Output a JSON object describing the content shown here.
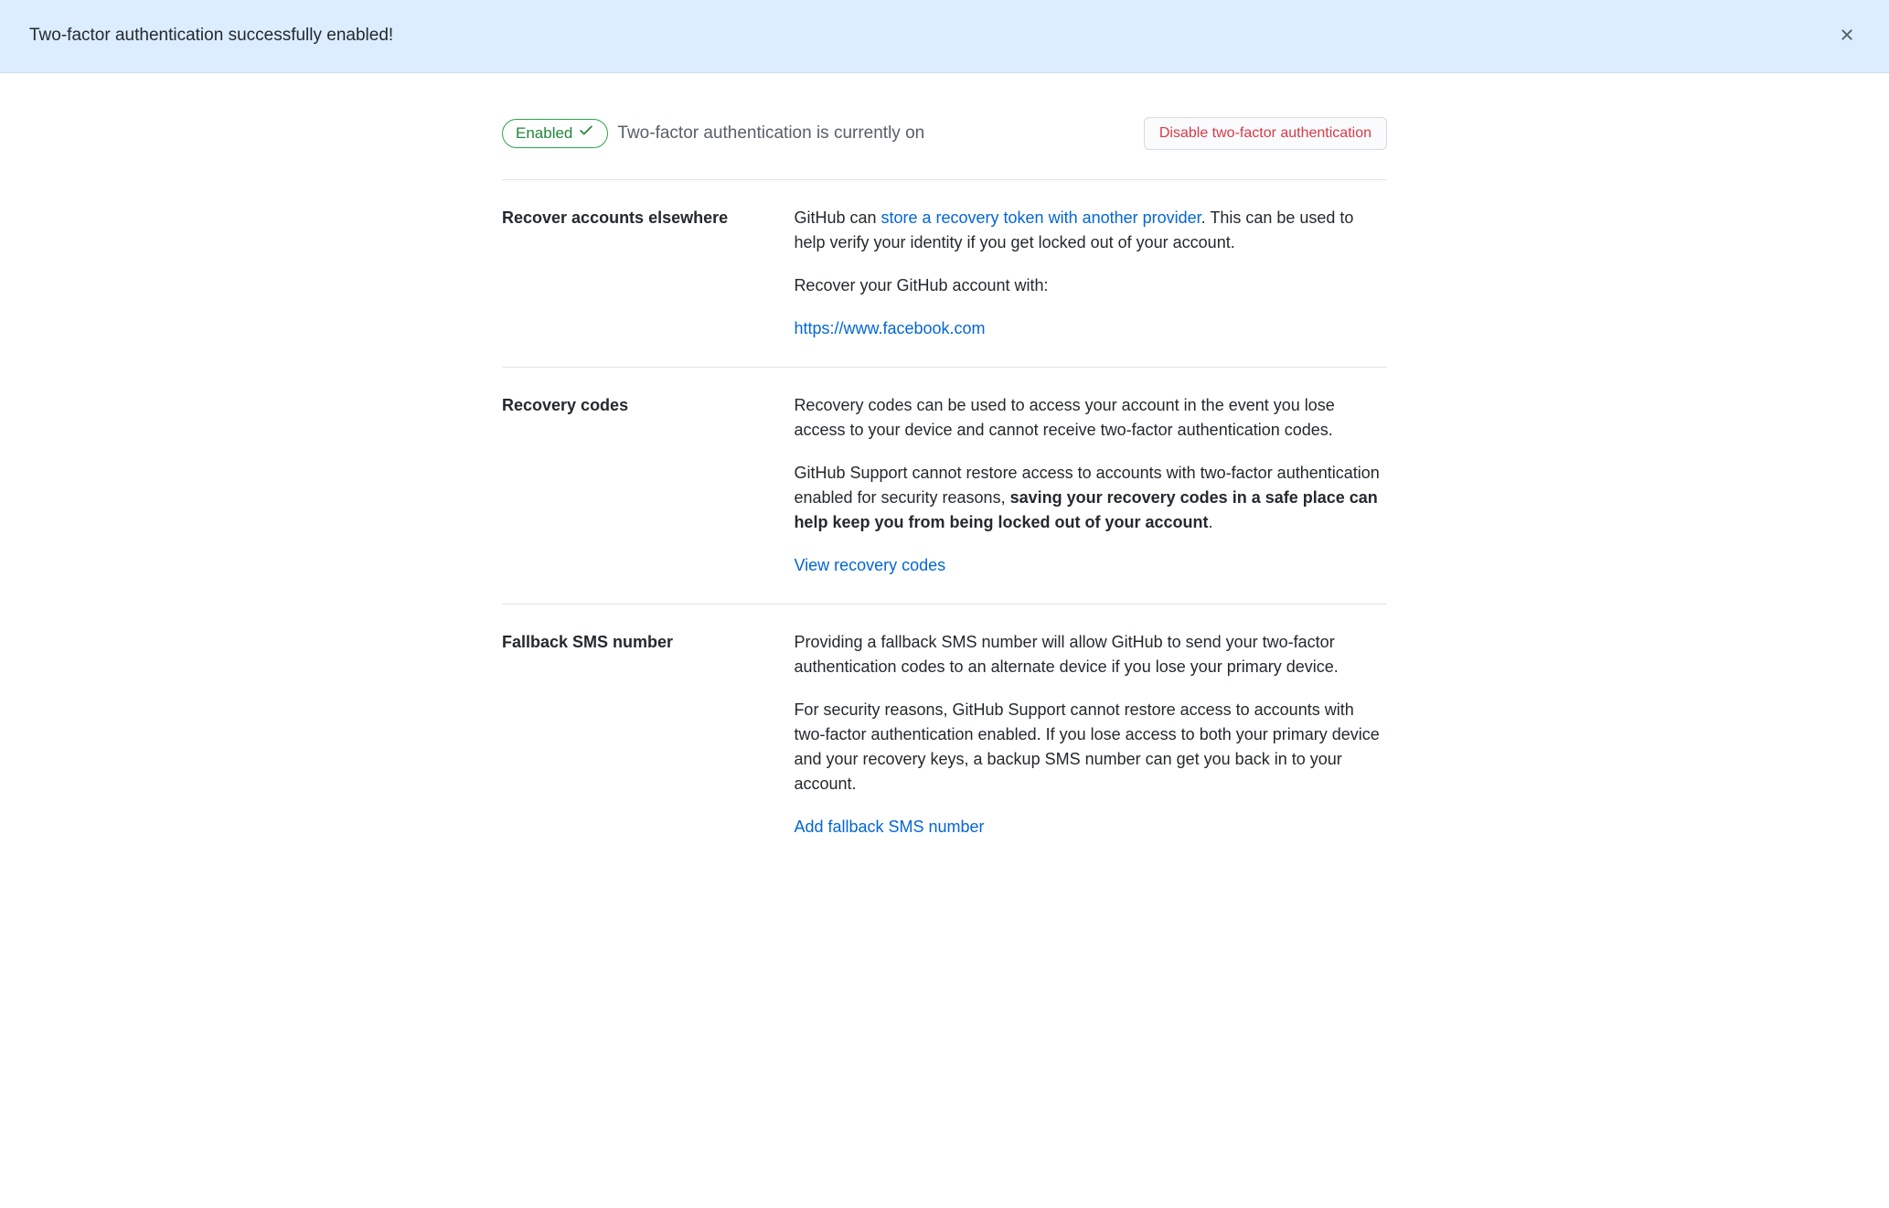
{
  "banner": {
    "text": "Two-factor authentication successfully enabled!"
  },
  "header": {
    "pill": "Enabled",
    "status_text": "Two-factor authentication is currently on",
    "disable_button": "Disable two-factor authentication"
  },
  "sections": {
    "recover_elsewhere": {
      "label": "Recover accounts elsewhere",
      "p1_a": "GitHub can ",
      "p1_link": "store a recovery token with another provider",
      "p1_b": ". This can be used to help verify your identity if you get locked out of your account.",
      "p2": "Recover your GitHub account with:",
      "provider_link": "https://www.facebook.com"
    },
    "recovery_codes": {
      "label": "Recovery codes",
      "p1": "Recovery codes can be used to access your account in the event you lose access to your device and cannot receive two-factor authentication codes.",
      "p2_a": "GitHub Support cannot restore access to accounts with two-factor authentication enabled for security reasons, ",
      "p2_strong": "saving your recovery codes in a safe place can help keep you from being locked out of your account",
      "p2_b": ".",
      "link": "View recovery codes"
    },
    "fallback_sms": {
      "label": "Fallback SMS number",
      "p1": "Providing a fallback SMS number will allow GitHub to send your two-factor authentication codes to an alternate device if you lose your primary device.",
      "p2": "For security reasons, GitHub Support cannot restore access to accounts with two-factor authentication enabled. If you lose access to both your primary device and your recovery keys, a backup SMS number can get you back in to your account.",
      "link": "Add fallback SMS number"
    }
  }
}
